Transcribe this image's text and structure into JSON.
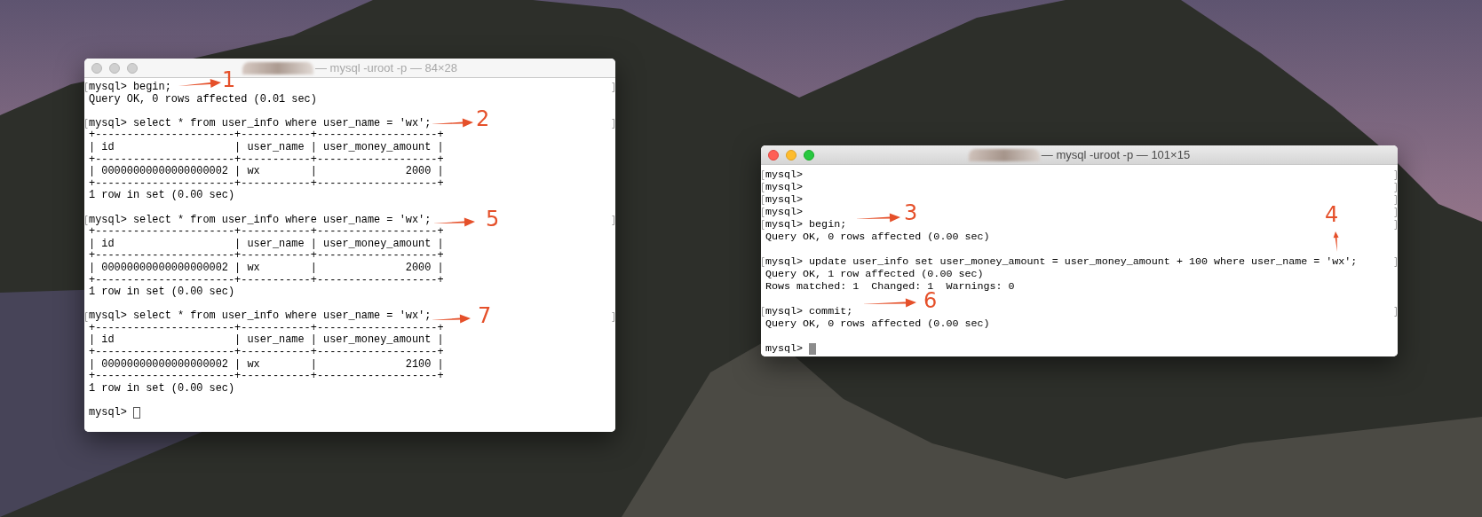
{
  "windows": [
    {
      "title": "— mysql -uroot -p — 84×28",
      "active": false,
      "lines": [
        {
          "kind": "prompt",
          "text": "mysql> begin;"
        },
        {
          "kind": "output",
          "text": "Query OK, 0 rows affected (0.01 sec)"
        },
        {
          "kind": "blank"
        },
        {
          "kind": "prompt",
          "text": "mysql> select * from user_info where user_name = 'wx';"
        },
        {
          "kind": "output",
          "text": "+----------------------+-----------+-------------------+"
        },
        {
          "kind": "output",
          "text": "| id                   | user_name | user_money_amount |"
        },
        {
          "kind": "output",
          "text": "+----------------------+-----------+-------------------+"
        },
        {
          "kind": "output",
          "text": "| 00000000000000000002 | wx        |              2000 |"
        },
        {
          "kind": "output",
          "text": "+----------------------+-----------+-------------------+"
        },
        {
          "kind": "output",
          "text": "1 row in set (0.00 sec)"
        },
        {
          "kind": "blank"
        },
        {
          "kind": "prompt",
          "text": "mysql> select * from user_info where user_name = 'wx';"
        },
        {
          "kind": "output",
          "text": "+----------------------+-----------+-------------------+"
        },
        {
          "kind": "output",
          "text": "| id                   | user_name | user_money_amount |"
        },
        {
          "kind": "output",
          "text": "+----------------------+-----------+-------------------+"
        },
        {
          "kind": "output",
          "text": "| 00000000000000000002 | wx        |              2000 |"
        },
        {
          "kind": "output",
          "text": "+----------------------+-----------+-------------------+"
        },
        {
          "kind": "output",
          "text": "1 row in set (0.00 sec)"
        },
        {
          "kind": "blank"
        },
        {
          "kind": "prompt",
          "text": "mysql> select * from user_info where user_name = 'wx';"
        },
        {
          "kind": "output",
          "text": "+----------------------+-----------+-------------------+"
        },
        {
          "kind": "output",
          "text": "| id                   | user_name | user_money_amount |"
        },
        {
          "kind": "output",
          "text": "+----------------------+-----------+-------------------+"
        },
        {
          "kind": "output",
          "text": "| 00000000000000000002 | wx        |              2100 |"
        },
        {
          "kind": "output",
          "text": "+----------------------+-----------+-------------------+"
        },
        {
          "kind": "output",
          "text": "1 row in set (0.00 sec)"
        },
        {
          "kind": "blank"
        },
        {
          "kind": "input",
          "text": "mysql>"
        }
      ]
    },
    {
      "title": "— mysql -uroot -p — 101×15",
      "active": true,
      "lines": [
        {
          "kind": "prompt",
          "text": "mysql>"
        },
        {
          "kind": "prompt",
          "text": "mysql>"
        },
        {
          "kind": "prompt",
          "text": "mysql>"
        },
        {
          "kind": "prompt",
          "text": "mysql>"
        },
        {
          "kind": "prompt",
          "text": "mysql> begin;"
        },
        {
          "kind": "output",
          "text": "Query OK, 0 rows affected (0.00 sec)"
        },
        {
          "kind": "blank"
        },
        {
          "kind": "prompt",
          "text": "mysql> update user_info set user_money_amount = user_money_amount + 100 where user_name = 'wx';"
        },
        {
          "kind": "output",
          "text": "Query OK, 1 row affected (0.00 sec)"
        },
        {
          "kind": "output",
          "text": "Rows matched: 1  Changed: 1  Warnings: 0"
        },
        {
          "kind": "blank"
        },
        {
          "kind": "prompt",
          "text": "mysql> commit;"
        },
        {
          "kind": "output",
          "text": "Query OK, 0 rows affected (0.00 sec)"
        },
        {
          "kind": "blank"
        },
        {
          "kind": "input",
          "text": "mysql>"
        }
      ]
    }
  ],
  "annotations": [
    {
      "label": "1",
      "kind": "horizontal"
    },
    {
      "label": "2",
      "kind": "horizontal"
    },
    {
      "label": "5",
      "kind": "horizontal"
    },
    {
      "label": "7",
      "kind": "horizontal"
    },
    {
      "label": "3",
      "kind": "horizontal"
    },
    {
      "label": "4",
      "kind": "vertical"
    },
    {
      "label": "6",
      "kind": "horizontal"
    }
  ]
}
